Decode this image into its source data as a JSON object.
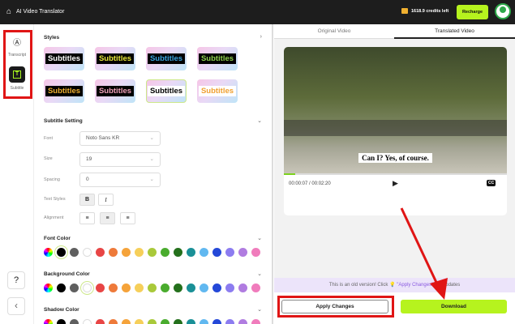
{
  "header": {
    "title": "AI Video Translator",
    "credits": "1618.9 credits left",
    "recharge": "Recharge"
  },
  "rail": {
    "transcript": "Transcript",
    "subtitle": "Subtitle",
    "help": "?",
    "collapse": "‹"
  },
  "styles": {
    "title": "Styles",
    "tiles": [
      {
        "text": "Subtitles",
        "fg": "#ffffff",
        "bg": "#000000"
      },
      {
        "text": "Subtitles",
        "fg": "#e8e83a",
        "bg": "#000000"
      },
      {
        "text": "Subtitles",
        "fg": "#3aa6e0",
        "bg": "#000000"
      },
      {
        "text": "Subtitles",
        "fg": "#8fd14f",
        "bg": "#000000"
      },
      {
        "text": "Subtitles",
        "fg": "#f0b030",
        "bg": "#000000"
      },
      {
        "text": "Subtitles",
        "fg": "#f0a0b8",
        "bg": "#000000"
      },
      {
        "text": "Subtitles",
        "fg": "#000000",
        "bg": "#ffffff"
      },
      {
        "text": "Subtitles",
        "fg": "#f0a030",
        "bg": "#ffffff"
      }
    ]
  },
  "subtitle_setting": {
    "title": "Subtitle Setting",
    "font_label": "Font",
    "font": "Noto Sans KR",
    "size_label": "Size",
    "size": "19",
    "spacing_label": "Spacing",
    "spacing": "0",
    "text_styles_label": "Text Styles",
    "bold": "B",
    "italic": "I",
    "alignment_label": "Alignment"
  },
  "colors": {
    "font_title": "Font Color",
    "bg_title": "Background Color",
    "shadow_title": "Shadow Color",
    "swatches": [
      "#000000",
      "#5f5f5f",
      "#ffffff",
      "#e84545",
      "#ee7a3a",
      "#f5a33a",
      "#f6cf5a",
      "#a9c93a",
      "#4aac2e",
      "#24701c",
      "#1a9097",
      "#61b8f0",
      "#2448d8",
      "#8c7cf0",
      "#b07ce0",
      "#f07cbc"
    ]
  },
  "tabs": {
    "original": "Original Video",
    "translated": "Translated Video"
  },
  "video": {
    "caption": "Can I? Yes, of course.",
    "time": "00:00:07 / 00:02:20",
    "cc": "CC",
    "progress": 0.05
  },
  "notice": {
    "pre": "This is an old version! Click",
    "link": "\"Apply Changes\"",
    "post": "the updates"
  },
  "actions": {
    "apply": "Apply Changes",
    "download": "Download"
  }
}
